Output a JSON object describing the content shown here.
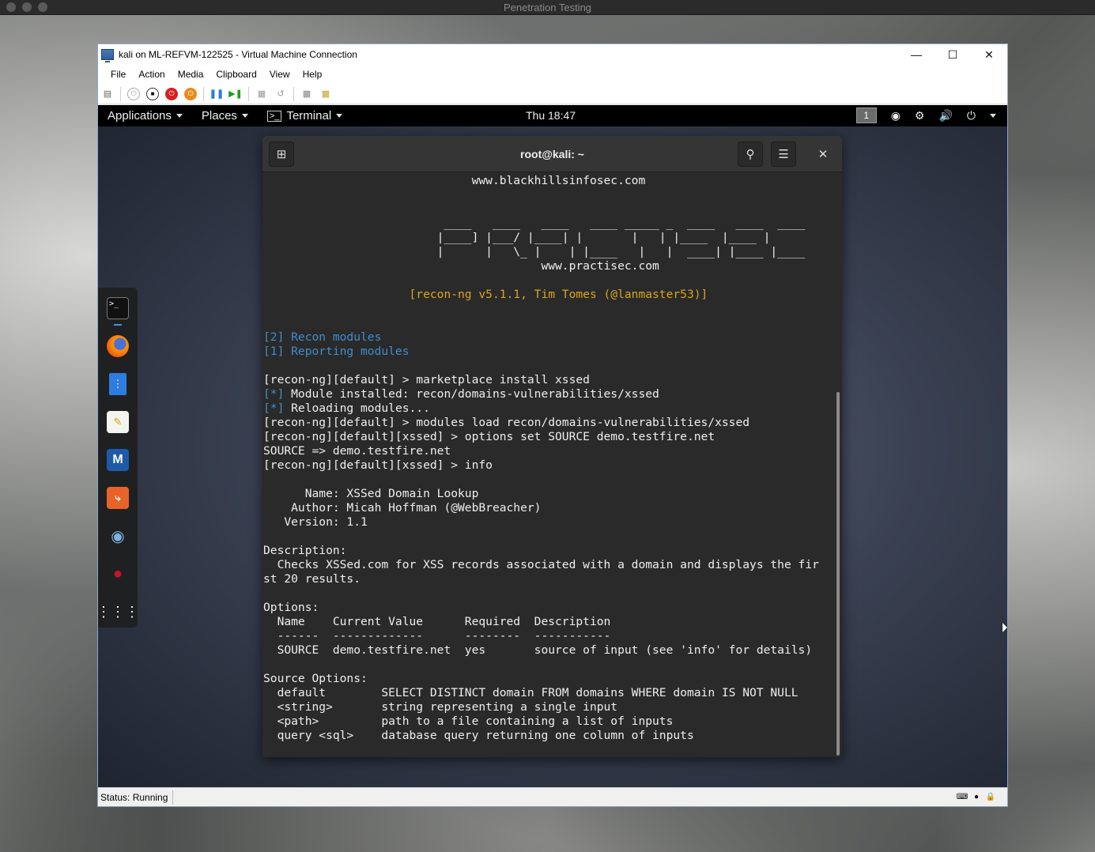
{
  "host": {
    "title": "Penetration Testing"
  },
  "vm_window": {
    "title": "kali on ML-REFVM-122525 - Virtual Machine Connection",
    "menu": [
      "File",
      "Action",
      "Media",
      "Clipboard",
      "View",
      "Help"
    ],
    "status": "Status: Running"
  },
  "gnome": {
    "applications": "Applications",
    "places": "Places",
    "terminal": "Terminal",
    "clock": "Thu 18:47",
    "workspace": "1"
  },
  "dock": {
    "items": [
      "terminal-icon",
      "firefox-icon",
      "files-icon",
      "text-editor-icon",
      "metasploit-icon",
      "burpsuite-icon",
      "eye-icon",
      "cherrytree-icon",
      "show-apps-icon"
    ]
  },
  "terminal": {
    "title": "root@kali: ~",
    "lines": [
      {
        "text": "                              www.blackhillsinfosec.com",
        "color": ""
      },
      {
        "text": "",
        "color": ""
      },
      {
        "text": "",
        "color": ""
      },
      {
        "text": "                          ____   ____   ____   ____ _____ _  ____   ____  ____",
        "color": ""
      },
      {
        "text": "                         |____] |___/ |____| |       |   | |____  |____ |",
        "color": ""
      },
      {
        "text": "                         |      |   \\_ |    | |____   |   |  ____| |____ |____",
        "color": ""
      },
      {
        "text": "                                        www.practisec.com",
        "color": ""
      },
      {
        "text": "",
        "color": ""
      },
      {
        "text": "                     [recon-ng v5.1.1, Tim Tomes (@lanmaster53)]",
        "color": "yellow"
      },
      {
        "text": "",
        "color": ""
      },
      {
        "text": "",
        "color": ""
      },
      {
        "text": "[2] Recon modules",
        "color": "blue"
      },
      {
        "text": "[1] Reporting modules",
        "color": "blue"
      },
      {
        "text": "",
        "color": ""
      },
      {
        "text": "[recon-ng][default] > marketplace install xssed",
        "color": ""
      },
      {
        "text": "[*] Module installed: recon/domains-vulnerabilities/xssed",
        "color": "star"
      },
      {
        "text": "[*] Reloading modules...",
        "color": "star"
      },
      {
        "text": "[recon-ng][default] > modules load recon/domains-vulnerabilities/xssed",
        "color": ""
      },
      {
        "text": "[recon-ng][default][xssed] > options set SOURCE demo.testfire.net",
        "color": ""
      },
      {
        "text": "SOURCE => demo.testfire.net",
        "color": ""
      },
      {
        "text": "[recon-ng][default][xssed] > info",
        "color": ""
      },
      {
        "text": "",
        "color": ""
      },
      {
        "text": "      Name: XSSed Domain Lookup",
        "color": ""
      },
      {
        "text": "    Author: Micah Hoffman (@WebBreacher)",
        "color": ""
      },
      {
        "text": "   Version: 1.1",
        "color": ""
      },
      {
        "text": "",
        "color": ""
      },
      {
        "text": "Description:",
        "color": ""
      },
      {
        "text": "  Checks XSSed.com for XSS records associated with a domain and displays the fir",
        "color": ""
      },
      {
        "text": "st 20 results.",
        "color": ""
      },
      {
        "text": "",
        "color": ""
      },
      {
        "text": "Options:",
        "color": ""
      },
      {
        "text": "  Name    Current Value      Required  Description",
        "color": ""
      },
      {
        "text": "  ------  -------------      --------  -----------",
        "color": ""
      },
      {
        "text": "  SOURCE  demo.testfire.net  yes       source of input (see 'info' for details)",
        "color": ""
      },
      {
        "text": "",
        "color": ""
      },
      {
        "text": "Source Options:",
        "color": ""
      },
      {
        "text": "  default        SELECT DISTINCT domain FROM domains WHERE domain IS NOT NULL",
        "color": ""
      },
      {
        "text": "  <string>       string representing a single input",
        "color": ""
      },
      {
        "text": "  <path>         path to a file containing a list of inputs",
        "color": ""
      },
      {
        "text": "  query <sql>    database query returning one column of inputs",
        "color": ""
      },
      {
        "text": "",
        "color": ""
      }
    ],
    "prompt": "[recon-ng][default][xssed] > "
  },
  "colors": {
    "blue": "#3f8dd0",
    "yellow": "#d9a520"
  }
}
